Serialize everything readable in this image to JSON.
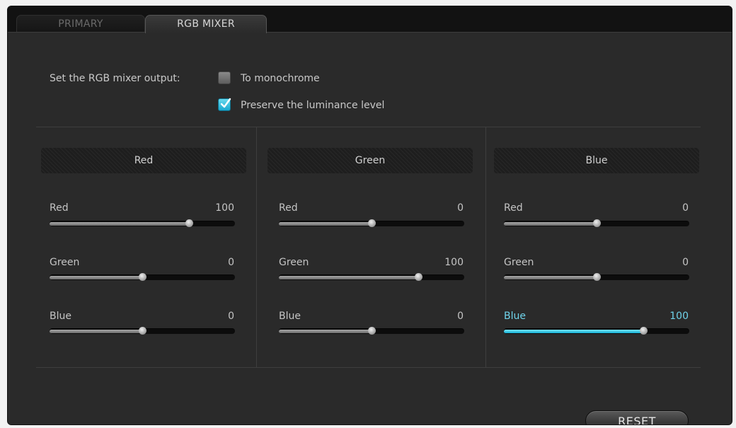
{
  "tabs": [
    {
      "label": "PRIMARY",
      "active": false
    },
    {
      "label": "RGB MIXER",
      "active": true
    }
  ],
  "output": {
    "label": "Set the RGB mixer output:",
    "options": [
      {
        "label": "To monochrome",
        "checked": false
      },
      {
        "label": "Preserve the luminance level",
        "checked": true
      }
    ]
  },
  "columns": [
    {
      "header": "Red",
      "sliders": [
        {
          "label": "Red",
          "value": "100",
          "level": 0.75
        },
        {
          "label": "Green",
          "value": "0",
          "level": 0.5
        },
        {
          "label": "Blue",
          "value": "0",
          "level": 0.5
        }
      ]
    },
    {
      "header": "Green",
      "sliders": [
        {
          "label": "Red",
          "value": "0",
          "level": 0.5
        },
        {
          "label": "Green",
          "value": "100",
          "level": 0.75
        },
        {
          "label": "Blue",
          "value": "0",
          "level": 0.5
        }
      ]
    },
    {
      "header": "Blue",
      "sliders": [
        {
          "label": "Red",
          "value": "0",
          "level": 0.5
        },
        {
          "label": "Green",
          "value": "0",
          "level": 0.5
        },
        {
          "label": "Blue",
          "value": "100",
          "level": 0.75,
          "active": true
        }
      ]
    }
  ],
  "reset_label": "RESET",
  "colors": {
    "accent": "#1ab8dc",
    "background": "#2a2a2a",
    "text": "#c9c9c9"
  }
}
